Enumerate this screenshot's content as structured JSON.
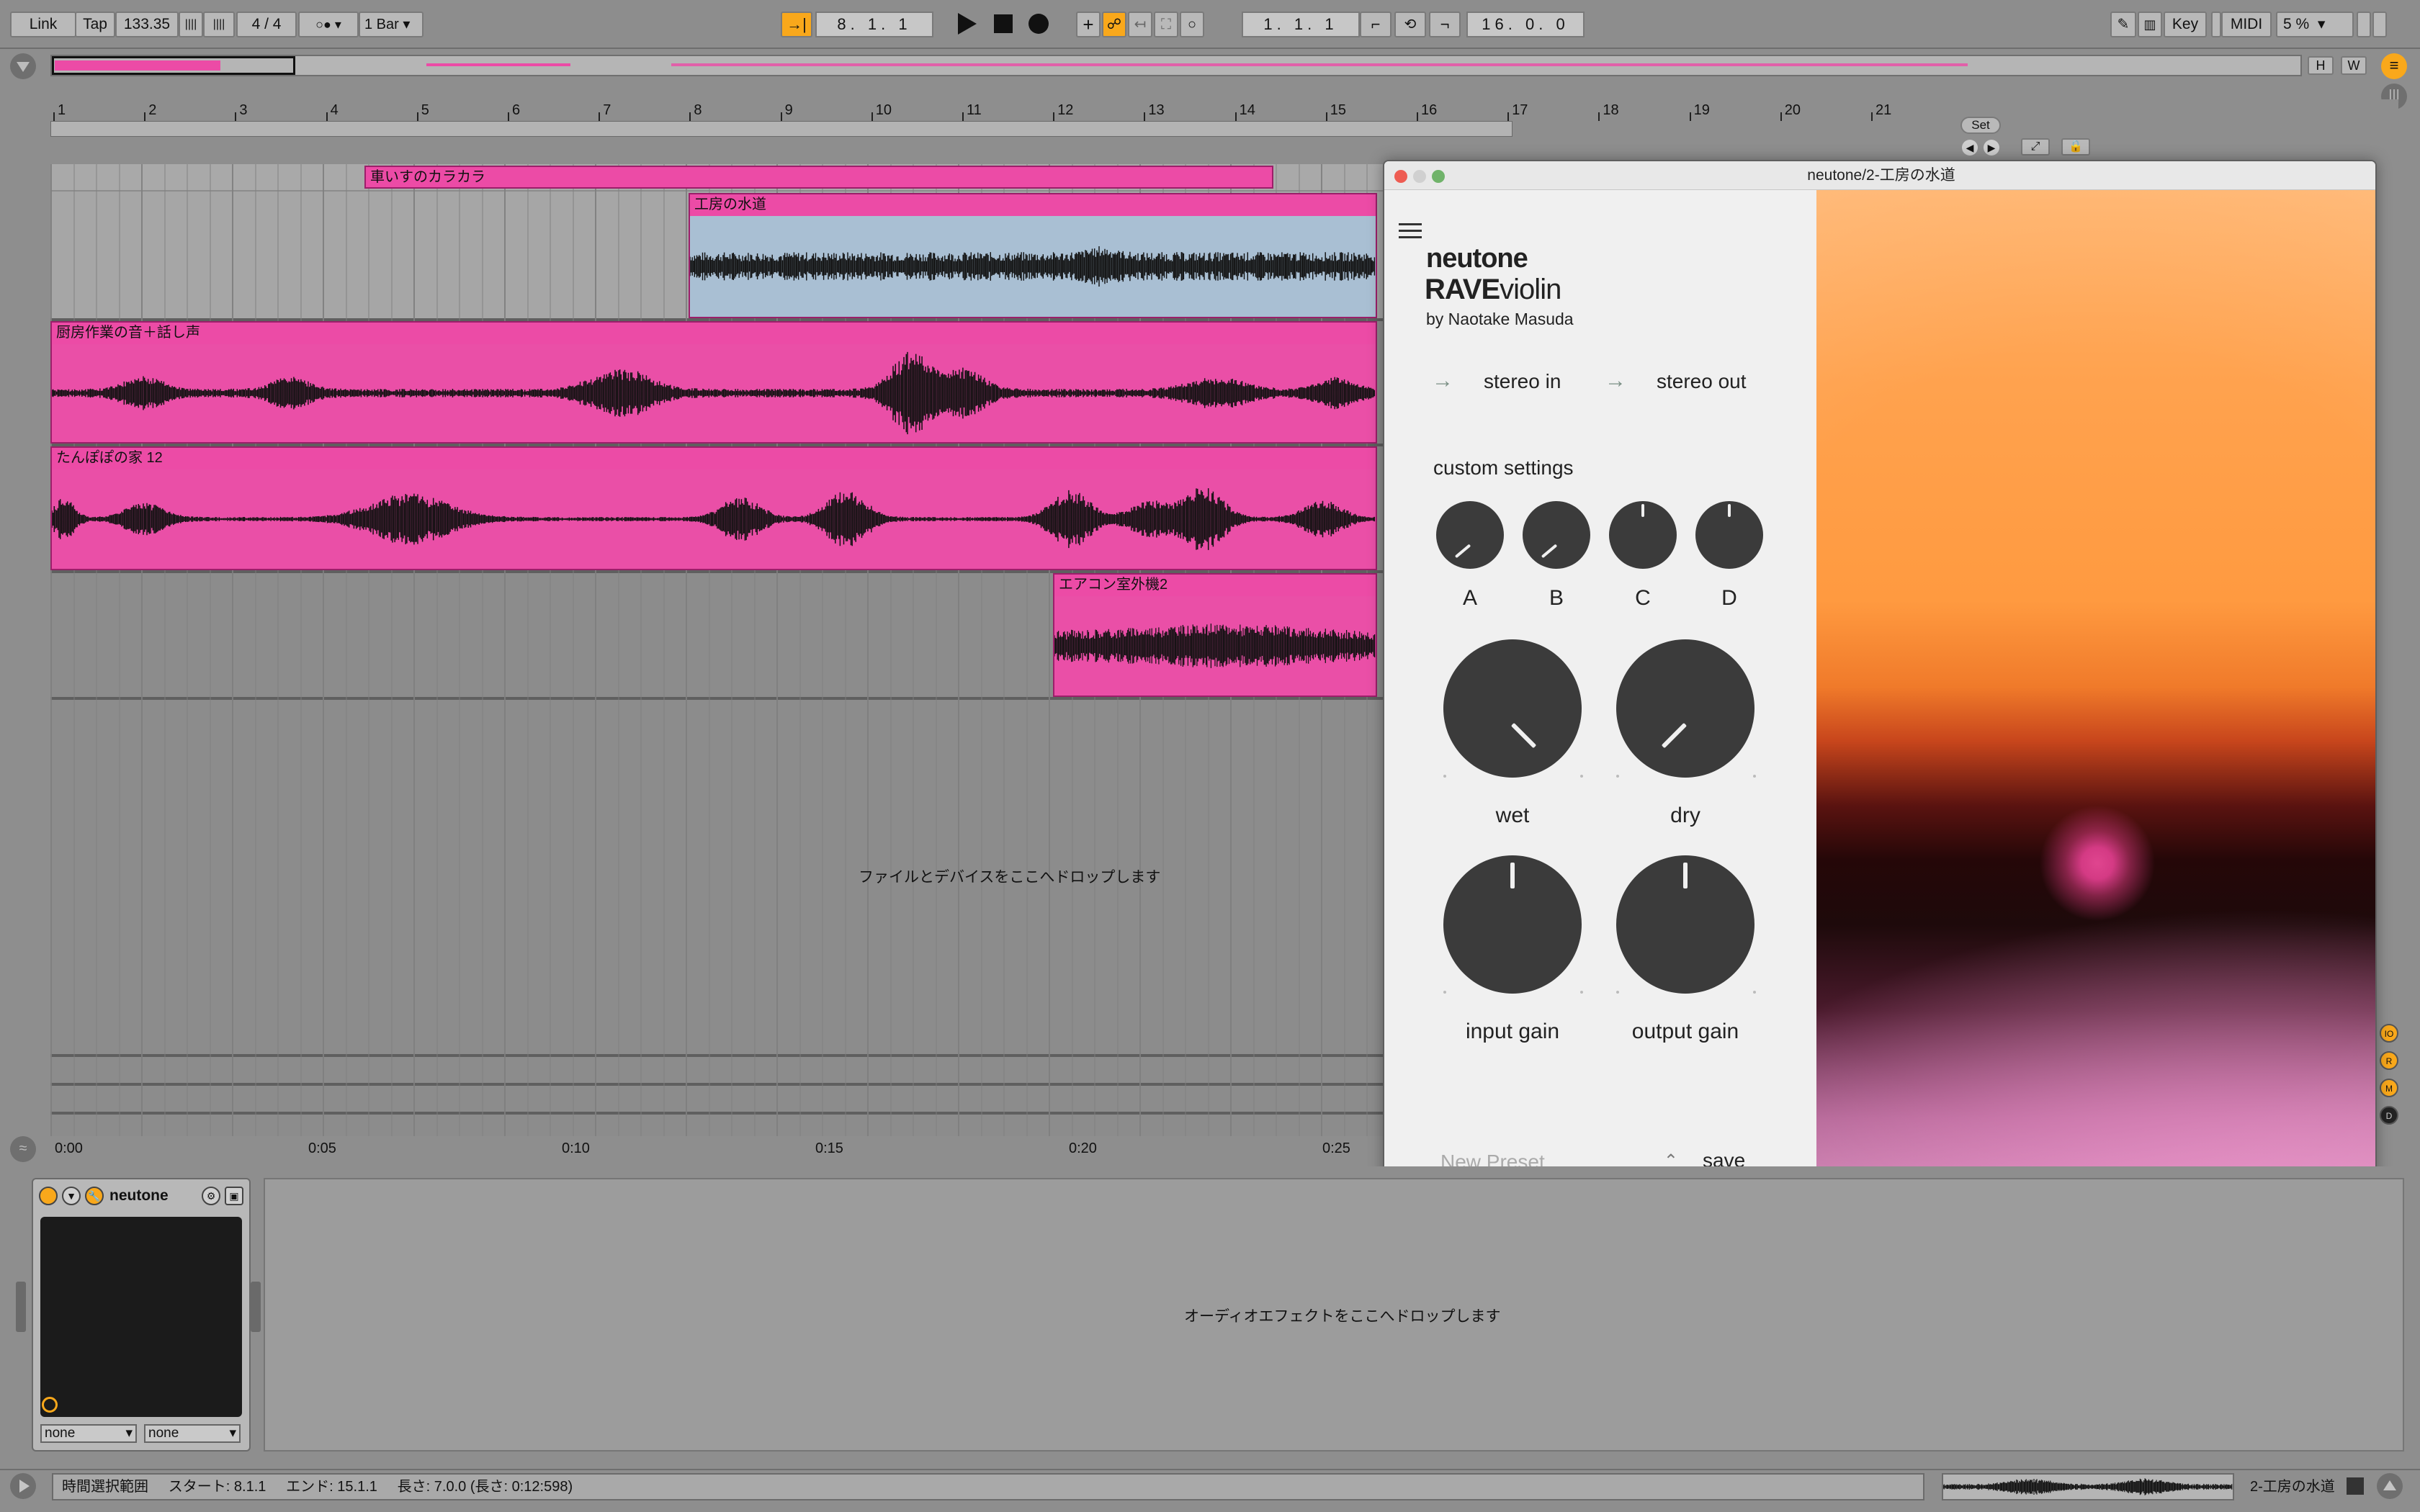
{
  "transport": {
    "link": "Link",
    "tap": "Tap",
    "tempo": "133.35",
    "meter": "4 / 4",
    "quantize": "1 Bar",
    "arrangement_position": "8.  1.  1",
    "loop_start": "1.  1.  1",
    "loop_length": "16.  0.  0",
    "key": "Key",
    "midi": "MIDI",
    "cpu": "5 %"
  },
  "overview": {
    "h_label": "H",
    "w_label": "W"
  },
  "ruler": {
    "bars": [
      "1",
      "2",
      "3",
      "4",
      "5",
      "6",
      "7",
      "8",
      "9",
      "10",
      "11",
      "12",
      "13",
      "14",
      "15",
      "16",
      "17",
      "18",
      "19",
      "20",
      "21"
    ],
    "set_label": "Set"
  },
  "clips": {
    "clip1": "車いすのカラカラ",
    "clip2": "工房の水道",
    "clip3": "厨房作業の音＋話し声",
    "clip4": "たんぽぽの家 12",
    "clip5": "エアコン室外機2"
  },
  "arrangement": {
    "drop_text": "ファイルとデバイスをここへドロップします"
  },
  "timeline": {
    "marks": [
      "0:00",
      "0:05",
      "0:10",
      "0:15",
      "0:20",
      "0:25"
    ]
  },
  "plugin": {
    "window_title": "neutone/2-工房の水道",
    "brand": "neutone",
    "model_bold": "RAVE",
    "model_light": "violin",
    "author": "by Naotake Masuda",
    "input_label": "stereo in",
    "output_label": "stereo out",
    "custom_settings": "custom settings",
    "knob_a": "A",
    "knob_b": "B",
    "knob_c": "C",
    "knob_d": "D",
    "wet": "wet",
    "dry": "dry",
    "input_gain": "input gain",
    "output_gain": "output gain",
    "preset_placeholder": "New Preset",
    "save": "save"
  },
  "device": {
    "name": "neutone",
    "sel1": "none",
    "sel2": "none"
  },
  "detail": {
    "drop_text": "オーディオエフェクトをここへドロップします"
  },
  "status": {
    "text": "時間選択範囲     スタート: 8.1.1     エンド: 15.1.1     長さ: 7.0.0 (長さ: 0:12:598)",
    "track_name": "2-工房の水道"
  },
  "side_buttons": [
    "IO",
    "R",
    "M",
    "D"
  ],
  "colors": {
    "clip_pink": "#ec4ba6",
    "clip_blue": "#a9bfd3",
    "accent_orange": "#f9a81b"
  }
}
